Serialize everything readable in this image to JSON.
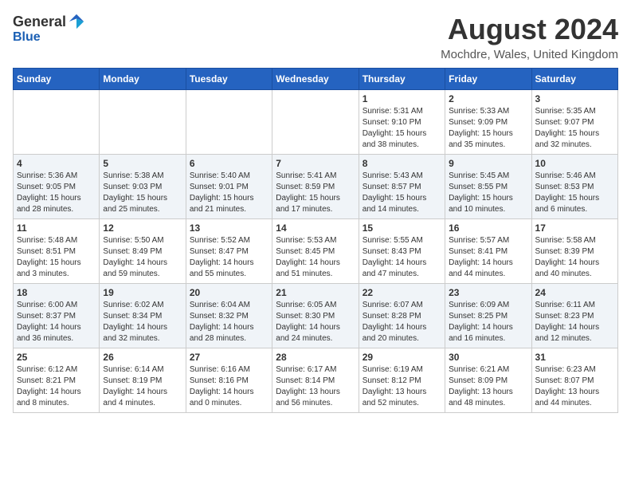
{
  "header": {
    "logo_general": "General",
    "logo_blue": "Blue",
    "title": "August 2024",
    "location": "Mochdre, Wales, United Kingdom"
  },
  "calendar": {
    "days_of_week": [
      "Sunday",
      "Monday",
      "Tuesday",
      "Wednesday",
      "Thursday",
      "Friday",
      "Saturday"
    ],
    "weeks": [
      [
        {
          "day": "",
          "info": ""
        },
        {
          "day": "",
          "info": ""
        },
        {
          "day": "",
          "info": ""
        },
        {
          "day": "",
          "info": ""
        },
        {
          "day": "1",
          "info": "Sunrise: 5:31 AM\nSunset: 9:10 PM\nDaylight: 15 hours\nand 38 minutes."
        },
        {
          "day": "2",
          "info": "Sunrise: 5:33 AM\nSunset: 9:09 PM\nDaylight: 15 hours\nand 35 minutes."
        },
        {
          "day": "3",
          "info": "Sunrise: 5:35 AM\nSunset: 9:07 PM\nDaylight: 15 hours\nand 32 minutes."
        }
      ],
      [
        {
          "day": "4",
          "info": "Sunrise: 5:36 AM\nSunset: 9:05 PM\nDaylight: 15 hours\nand 28 minutes."
        },
        {
          "day": "5",
          "info": "Sunrise: 5:38 AM\nSunset: 9:03 PM\nDaylight: 15 hours\nand 25 minutes."
        },
        {
          "day": "6",
          "info": "Sunrise: 5:40 AM\nSunset: 9:01 PM\nDaylight: 15 hours\nand 21 minutes."
        },
        {
          "day": "7",
          "info": "Sunrise: 5:41 AM\nSunset: 8:59 PM\nDaylight: 15 hours\nand 17 minutes."
        },
        {
          "day": "8",
          "info": "Sunrise: 5:43 AM\nSunset: 8:57 PM\nDaylight: 15 hours\nand 14 minutes."
        },
        {
          "day": "9",
          "info": "Sunrise: 5:45 AM\nSunset: 8:55 PM\nDaylight: 15 hours\nand 10 minutes."
        },
        {
          "day": "10",
          "info": "Sunrise: 5:46 AM\nSunset: 8:53 PM\nDaylight: 15 hours\nand 6 minutes."
        }
      ],
      [
        {
          "day": "11",
          "info": "Sunrise: 5:48 AM\nSunset: 8:51 PM\nDaylight: 15 hours\nand 3 minutes."
        },
        {
          "day": "12",
          "info": "Sunrise: 5:50 AM\nSunset: 8:49 PM\nDaylight: 14 hours\nand 59 minutes."
        },
        {
          "day": "13",
          "info": "Sunrise: 5:52 AM\nSunset: 8:47 PM\nDaylight: 14 hours\nand 55 minutes."
        },
        {
          "day": "14",
          "info": "Sunrise: 5:53 AM\nSunset: 8:45 PM\nDaylight: 14 hours\nand 51 minutes."
        },
        {
          "day": "15",
          "info": "Sunrise: 5:55 AM\nSunset: 8:43 PM\nDaylight: 14 hours\nand 47 minutes."
        },
        {
          "day": "16",
          "info": "Sunrise: 5:57 AM\nSunset: 8:41 PM\nDaylight: 14 hours\nand 44 minutes."
        },
        {
          "day": "17",
          "info": "Sunrise: 5:58 AM\nSunset: 8:39 PM\nDaylight: 14 hours\nand 40 minutes."
        }
      ],
      [
        {
          "day": "18",
          "info": "Sunrise: 6:00 AM\nSunset: 8:37 PM\nDaylight: 14 hours\nand 36 minutes."
        },
        {
          "day": "19",
          "info": "Sunrise: 6:02 AM\nSunset: 8:34 PM\nDaylight: 14 hours\nand 32 minutes."
        },
        {
          "day": "20",
          "info": "Sunrise: 6:04 AM\nSunset: 8:32 PM\nDaylight: 14 hours\nand 28 minutes."
        },
        {
          "day": "21",
          "info": "Sunrise: 6:05 AM\nSunset: 8:30 PM\nDaylight: 14 hours\nand 24 minutes."
        },
        {
          "day": "22",
          "info": "Sunrise: 6:07 AM\nSunset: 8:28 PM\nDaylight: 14 hours\nand 20 minutes."
        },
        {
          "day": "23",
          "info": "Sunrise: 6:09 AM\nSunset: 8:25 PM\nDaylight: 14 hours\nand 16 minutes."
        },
        {
          "day": "24",
          "info": "Sunrise: 6:11 AM\nSunset: 8:23 PM\nDaylight: 14 hours\nand 12 minutes."
        }
      ],
      [
        {
          "day": "25",
          "info": "Sunrise: 6:12 AM\nSunset: 8:21 PM\nDaylight: 14 hours\nand 8 minutes."
        },
        {
          "day": "26",
          "info": "Sunrise: 6:14 AM\nSunset: 8:19 PM\nDaylight: 14 hours\nand 4 minutes."
        },
        {
          "day": "27",
          "info": "Sunrise: 6:16 AM\nSunset: 8:16 PM\nDaylight: 14 hours\nand 0 minutes."
        },
        {
          "day": "28",
          "info": "Sunrise: 6:17 AM\nSunset: 8:14 PM\nDaylight: 13 hours\nand 56 minutes."
        },
        {
          "day": "29",
          "info": "Sunrise: 6:19 AM\nSunset: 8:12 PM\nDaylight: 13 hours\nand 52 minutes."
        },
        {
          "day": "30",
          "info": "Sunrise: 6:21 AM\nSunset: 8:09 PM\nDaylight: 13 hours\nand 48 minutes."
        },
        {
          "day": "31",
          "info": "Sunrise: 6:23 AM\nSunset: 8:07 PM\nDaylight: 13 hours\nand 44 minutes."
        }
      ]
    ]
  }
}
